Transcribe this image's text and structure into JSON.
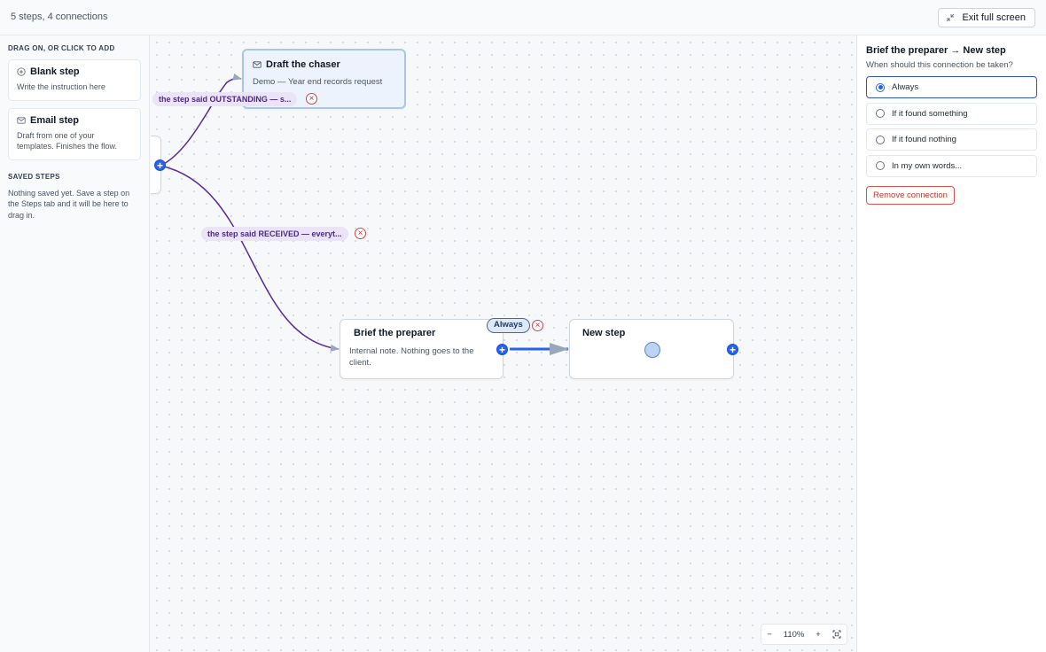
{
  "topbar": {
    "summary": "5 steps, 4 connections",
    "exit_label": "Exit full screen",
    "exit_icon": "minimize-icon"
  },
  "palette": {
    "title": "DRAG ON, OR CLICK TO ADD",
    "items": [
      {
        "title": "Blank step",
        "description": "Write the instruction here",
        "icon": "plus-circle-icon"
      },
      {
        "title": "Email step",
        "description": "Draft from one of your templates. Finishes the flow.",
        "icon": "mail-icon"
      }
    ],
    "saved_title": "SAVED STEPS",
    "saved_description": "Nothing saved yet. Save a step on the Steps tab and it will be here to drag in."
  },
  "canvas": {
    "nodes": {
      "chaser": {
        "title": "Draft the chaser",
        "description": "Demo — Year end records request",
        "icon": "mail-icon"
      },
      "brief": {
        "title": "Brief the preparer",
        "description": "Internal note. Nothing goes to the client."
      },
      "new_step": {
        "title": "New step"
      }
    },
    "edge_labels": {
      "outstanding": "the step said OUTSTANDING — s...",
      "received": "the step said RECEIVED — everyt...",
      "always": "Always"
    },
    "remove_glyph": "×",
    "add_glyph": "+",
    "colors": {
      "edge_purple": "#5b2a9a",
      "edge_selected": "#2563eb",
      "accent": "#2563eb"
    }
  },
  "zoom": {
    "minus": "−",
    "level": "110%",
    "plus": "+",
    "fit_icon": "fit-view-icon"
  },
  "inspector": {
    "title": "Brief the preparer → New step",
    "question": "When should this connection be taken?",
    "options": [
      {
        "label": "Always",
        "selected": true
      },
      {
        "label": "If it found something",
        "selected": false
      },
      {
        "label": "If it found nothing",
        "selected": false
      },
      {
        "label": "In my own words...",
        "selected": false
      }
    ],
    "remove_label": "Remove connection"
  }
}
